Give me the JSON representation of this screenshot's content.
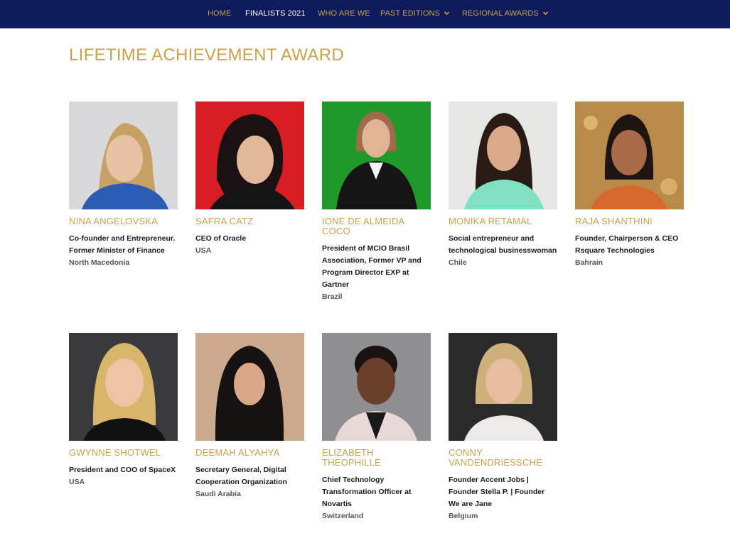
{
  "nav": {
    "items": [
      {
        "label": "HOME",
        "active": false,
        "dropdown": false
      },
      {
        "label": "FINALISTS 2021",
        "active": true,
        "dropdown": false
      },
      {
        "label": "WHO ARE WE",
        "active": false,
        "dropdown": false
      },
      {
        "label": "PAST EDITIONS",
        "active": false,
        "dropdown": true,
        "icon": "chevron-down-icon"
      },
      {
        "label": "REGIONAL AWARDS",
        "active": false,
        "dropdown": true,
        "icon": "chevron-down-icon"
      }
    ]
  },
  "page": {
    "title": "LIFETIME ACHIEVEMENT AWARD"
  },
  "colors": {
    "nav_bg": "#0d1a5c",
    "accent_gold": "#c9a24a",
    "active_nav": "#ffffff",
    "text": "#1a1a1a"
  },
  "finalists": [
    {
      "name": "NINA ANGELOVSKA",
      "role": "Co-founder and Entrepreneur. Former Minister of Finance",
      "country": "North Macedonia",
      "photo_bg": "#d9d9dc"
    },
    {
      "name": "SAFRA CATZ",
      "role": "CEO of Oracle",
      "country": "USA",
      "photo_bg": "#d81e22"
    },
    {
      "name": "IONE DE ALMEIDA COCO",
      "role": "President of MCIO Brasil Association, Former VP and Program Director EXP at Gartner",
      "country": "Brazil",
      "photo_bg": "#1f9a2a"
    },
    {
      "name": "MONIKA RETAMAL",
      "role": "Social entrepreneur and technological businesswoman",
      "country": "Chile",
      "photo_bg": "#e6e6e4"
    },
    {
      "name": "RAJA SHANTHINI",
      "role": "Founder, Chairperson & CEO Rsquare Technologies",
      "country": "Bahrain",
      "photo_bg": "#b98a4a"
    },
    {
      "name": "GWYNNE SHOTWEL",
      "role": "President and COO of SpaceX",
      "country": "USA",
      "photo_bg": "#3a3a3e"
    },
    {
      "name": "DEEMAH ALYAHYA",
      "role": "Secretary General, Digital Cooperation Organization",
      "country": "Saudi Arabia",
      "photo_bg": "#caa98c"
    },
    {
      "name": "ELIZABETH THEOPHILLE",
      "role": "Chief Technology Transformation Officer at Novartis",
      "country": "Switzerland",
      "photo_bg": "#8f8f93"
    },
    {
      "name": "CONNY VANDENDRIESSCHE",
      "role": "Founder Accent Jobs | Founder Stella P. | Founder We are Jane",
      "country": "Belgium",
      "photo_bg": "#2a2a2a"
    }
  ]
}
